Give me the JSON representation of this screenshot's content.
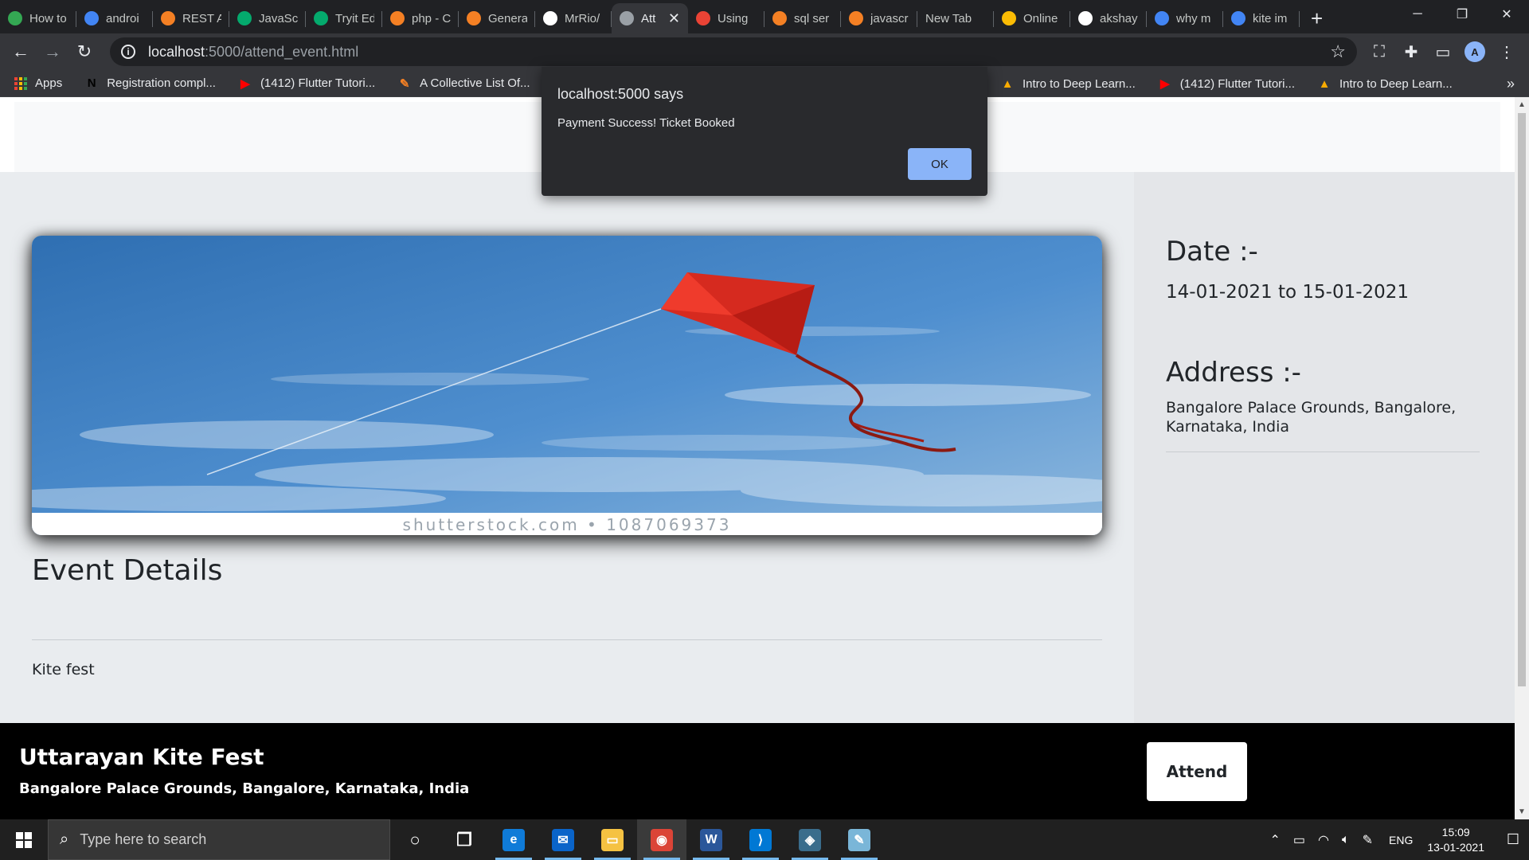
{
  "browser": {
    "tabs": [
      {
        "title": "How to",
        "favicon": "leaf-icon",
        "color": "#34a853"
      },
      {
        "title": "androi",
        "favicon": "google-icon",
        "color": "#4285f4"
      },
      {
        "title": "REST A",
        "favicon": "stackoverflow-icon",
        "color": "#f48024"
      },
      {
        "title": "JavaSc",
        "favicon": "w3schools-icon",
        "color": "#04aa6d"
      },
      {
        "title": "Tryit Ed",
        "favicon": "w3schools-icon",
        "color": "#04aa6d"
      },
      {
        "title": "php - C",
        "favicon": "stackoverflow-icon",
        "color": "#f48024"
      },
      {
        "title": "Genera",
        "favicon": "stackoverflow-icon",
        "color": "#f48024"
      },
      {
        "title": "MrRio/",
        "favicon": "github-icon",
        "color": "#ffffff"
      },
      {
        "title": "Att",
        "favicon": "globe-icon",
        "color": "#9aa0a6",
        "active": true
      },
      {
        "title": "Using",
        "favicon": "gmail-icon",
        "color": "#ea4335"
      },
      {
        "title": "sql ser",
        "favicon": "stackoverflow-icon",
        "color": "#f48024"
      },
      {
        "title": "javascr",
        "favicon": "stackoverflow-icon",
        "color": "#f48024"
      },
      {
        "title": "New Tab",
        "favicon": "",
        "color": ""
      },
      {
        "title": "Online",
        "favicon": "slides-icon",
        "color": "#fbbc04"
      },
      {
        "title": "akshay",
        "favicon": "github-icon",
        "color": "#ffffff"
      },
      {
        "title": "why m",
        "favicon": "google-icon",
        "color": "#4285f4"
      },
      {
        "title": "kite im",
        "favicon": "google-icon",
        "color": "#4285f4"
      }
    ],
    "address": {
      "host": "localhost",
      "path": ":5000/attend_event.html"
    },
    "profile_initial": "A",
    "bookmarks_left": [
      {
        "label": "Apps",
        "icon": "apps-grid-icon"
      },
      {
        "label": "Registration compl...",
        "icon": "n-logo-icon",
        "color": "#000000",
        "glyph": "N"
      },
      {
        "label": "(1412) Flutter Tutori...",
        "icon": "youtube-icon",
        "color": "#ff0000",
        "glyph": "▶"
      },
      {
        "label": "A Collective List Of...",
        "icon": "pen-icon",
        "color": "#f48024",
        "glyph": "✎"
      }
    ],
    "bookmarks_right": [
      {
        "label": "Intro to Deep Learn...",
        "icon": "flame-icon",
        "color": "#f9ab00",
        "glyph": "▲"
      },
      {
        "label": "(1412) Flutter Tutori...",
        "icon": "youtube-icon",
        "color": "#ff0000",
        "glyph": "▶"
      },
      {
        "label": "Intro to Deep Learn...",
        "icon": "flame-icon",
        "color": "#f9ab00",
        "glyph": "▲"
      }
    ]
  },
  "dialog": {
    "title": "localhost:5000 says",
    "message": "Payment Success! Ticket Booked",
    "ok_label": "OK"
  },
  "event": {
    "image_watermark": "shutterstock.com • 1087069373",
    "details_heading": "Event Details",
    "description": "Kite fest",
    "date_label": "Date :-",
    "date_value": "14-01-2021 to 15-01-2021",
    "address_label": "Address :-",
    "address_value": "Bangalore Palace Grounds, Bangalore, Karnataka, India",
    "footer_title": "Uttarayan Kite Fest",
    "footer_subtitle": "Bangalore Palace Grounds, Bangalore, Karnataka, India",
    "attend_label": "Attend"
  },
  "taskbar": {
    "search_placeholder": "Type here to search",
    "apps": [
      {
        "name": "cortana-icon",
        "glyph": "○",
        "color": ""
      },
      {
        "name": "task-view-icon",
        "glyph": "❐",
        "color": ""
      },
      {
        "name": "edge-icon",
        "glyph": "e",
        "color": "#0f7bd8"
      },
      {
        "name": "mail-icon",
        "glyph": "✉",
        "color": "#0a64c9"
      },
      {
        "name": "file-explorer-icon",
        "glyph": "▭",
        "color": "#f5c242"
      },
      {
        "name": "chrome-icon",
        "glyph": "◉",
        "color": "#db4437"
      },
      {
        "name": "word-icon",
        "glyph": "W",
        "color": "#2b579a"
      },
      {
        "name": "vscode-icon",
        "glyph": "⟩",
        "color": "#0078d4"
      },
      {
        "name": "mysql-workbench-icon",
        "glyph": "◈",
        "color": "#3a6d8c"
      },
      {
        "name": "notepad-icon",
        "glyph": "✎",
        "color": "#7ab6d8"
      }
    ],
    "language": "ENG",
    "time": "15:09",
    "date": "13-01-2021"
  }
}
